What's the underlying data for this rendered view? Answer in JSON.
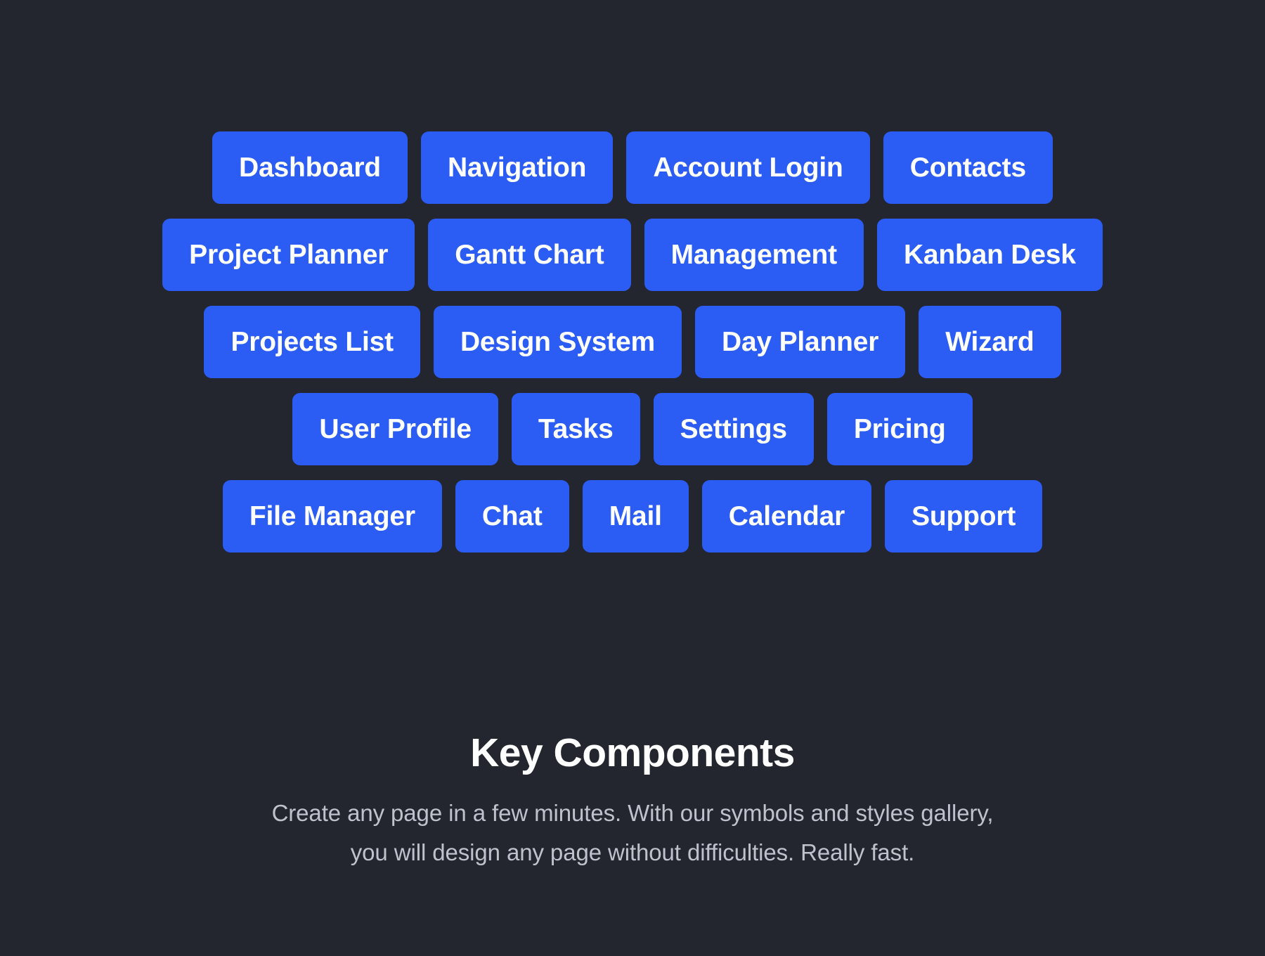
{
  "theme": {
    "background": "#24262f",
    "chip_background": "#2b5cf4",
    "chip_text": "#ffffff",
    "title_color": "#ffffff",
    "subtitle_color": "#bfc2cc"
  },
  "chip_rows": [
    {
      "row_index": 1,
      "chips": [
        {
          "label": "Dashboard"
        },
        {
          "label": "Navigation"
        },
        {
          "label": "Account Login"
        },
        {
          "label": "Contacts"
        }
      ]
    },
    {
      "row_index": 2,
      "chips": [
        {
          "label": "Project Planner"
        },
        {
          "label": "Gantt Chart"
        },
        {
          "label": "Management"
        },
        {
          "label": "Kanban Desk"
        }
      ]
    },
    {
      "row_index": 3,
      "chips": [
        {
          "label": "Projects List"
        },
        {
          "label": "Design System"
        },
        {
          "label": "Day Planner"
        },
        {
          "label": "Wizard"
        }
      ]
    },
    {
      "row_index": 4,
      "chips": [
        {
          "label": "User Profile"
        },
        {
          "label": "Tasks"
        },
        {
          "label": "Settings"
        },
        {
          "label": "Pricing"
        }
      ]
    },
    {
      "row_index": 5,
      "chips": [
        {
          "label": "File Manager"
        },
        {
          "label": "Chat"
        },
        {
          "label": "Mail"
        },
        {
          "label": "Calendar"
        },
        {
          "label": "Support"
        }
      ]
    }
  ],
  "footer": {
    "title": "Key Components",
    "subtitle_line_1": "Create any page in a few minutes. With our symbols and styles gallery,",
    "subtitle_line_2": "you will design any page without difficulties. Really fast."
  }
}
